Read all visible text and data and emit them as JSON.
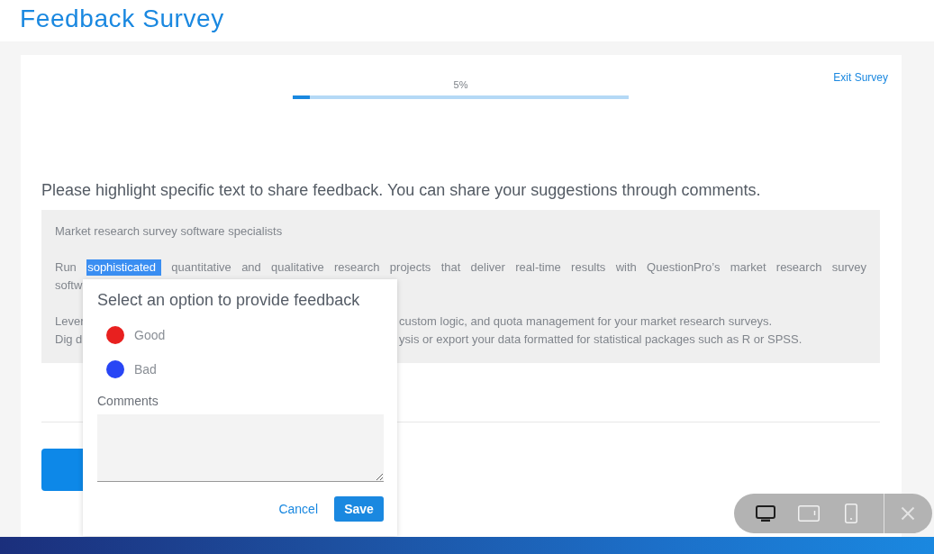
{
  "header": {
    "title": "Feedback Survey"
  },
  "survey": {
    "progress": {
      "label": "5%",
      "level": 0.05
    },
    "exit_link": "Exit Survey",
    "question": "Please highlight specific text to share feedback. You can share your suggestions through comments.",
    "passage": [
      {
        "lines": [
          {
            "kind": "plain",
            "parts": [
              {
                "text": "Market research survey software specialists",
                "highlighted": false
              }
            ]
          }
        ]
      },
      {
        "lines": [
          {
            "kind": "justified",
            "parts": [
              {
                "text": "Run",
                "highlighted": false
              },
              {
                "text": "sophisticated",
                "highlighted": true
              },
              {
                "text": "quantitative and qualitative research projects that deliver real-time results with QuestionPro’s market research survey",
                "highlighted": false
              }
            ]
          },
          {
            "kind": "plain",
            "parts": [
              {
                "text": "softw",
                "highlighted": false
              }
            ]
          }
        ]
      },
      {
        "lines": [
          {
            "kind": "split",
            "parts": [
              {
                "text": "Lever",
                "highlighted": false
              },
              {
                "text": "custom logic, and quota management for your market research surveys.",
                "highlighted": false
              }
            ]
          },
          {
            "kind": "split",
            "parts": [
              {
                "text": "Dig d",
                "highlighted": false
              },
              {
                "text": "ysis or export your data formatted for statistical packages such as R or SPSS.",
                "highlighted": false
              }
            ]
          }
        ]
      }
    ],
    "feedback_popup": {
      "title": "Select an option to provide feedback",
      "options": [
        {
          "label": "Good",
          "color": "#e8201f",
          "selected": false
        },
        {
          "label": "Bad",
          "color": "#2845f5",
          "selected": false
        }
      ],
      "comments_label": "Comments",
      "buttons": [
        {
          "label": "Cancel",
          "kind": "link"
        },
        {
          "label": "Save",
          "kind": "primary"
        }
      ]
    }
  },
  "device_bar": {
    "devices": [
      {
        "kind": "desktop",
        "selected": true
      },
      {
        "kind": "tablet",
        "selected": false
      },
      {
        "kind": "phone",
        "selected": false
      }
    ]
  }
}
